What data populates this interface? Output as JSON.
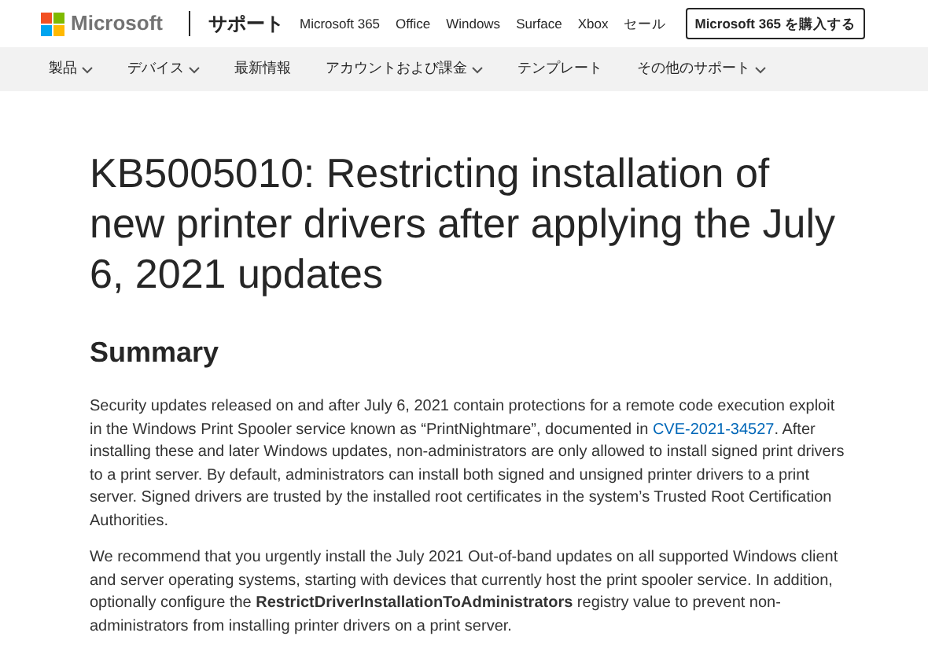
{
  "header": {
    "brand": "Microsoft",
    "section": "サポート",
    "links": [
      "Microsoft 365",
      "Office",
      "Windows",
      "Surface",
      "Xbox",
      "セール"
    ],
    "buy_button": "Microsoft 365 を購入する"
  },
  "nav": [
    {
      "label": "製品",
      "dropdown": true
    },
    {
      "label": "デバイス",
      "dropdown": true
    },
    {
      "label": "最新情報",
      "dropdown": false
    },
    {
      "label": "アカウントおよび課金",
      "dropdown": true
    },
    {
      "label": "テンプレート",
      "dropdown": false
    },
    {
      "label": "その他のサポート",
      "dropdown": true
    }
  ],
  "article": {
    "title": "KB5005010: Restricting installation of new printer drivers after applying the July 6, 2021 updates",
    "heading": "Summary",
    "paragraph_1": {
      "before": "Security updates released on and after July 6, 2021 contain protections for a remote code execution exploit in the Windows Print Spooler service known as “PrintNightmare”, documented in ",
      "link": "CVE-2021-34527",
      "after": ". After installing these and later Windows updates, non-administrators are only allowed to install signed print drivers to a print server. By default, administrators can install both signed and unsigned printer drivers to a print server. Signed drivers are trusted by the installed root certificates in the system’s Trusted Root Certification Authorities."
    },
    "paragraph_2": "We recommend that you urgently install the July 2021 Out-of-band updates on all supported Windows client and server operating systems, starting with devices that currently host the print spooler service. In addition, optionally configure the **RestrictDriverInstallationToAdministrators** registry value to prevent non-administrators from installing printer drivers on a print server."
  }
}
